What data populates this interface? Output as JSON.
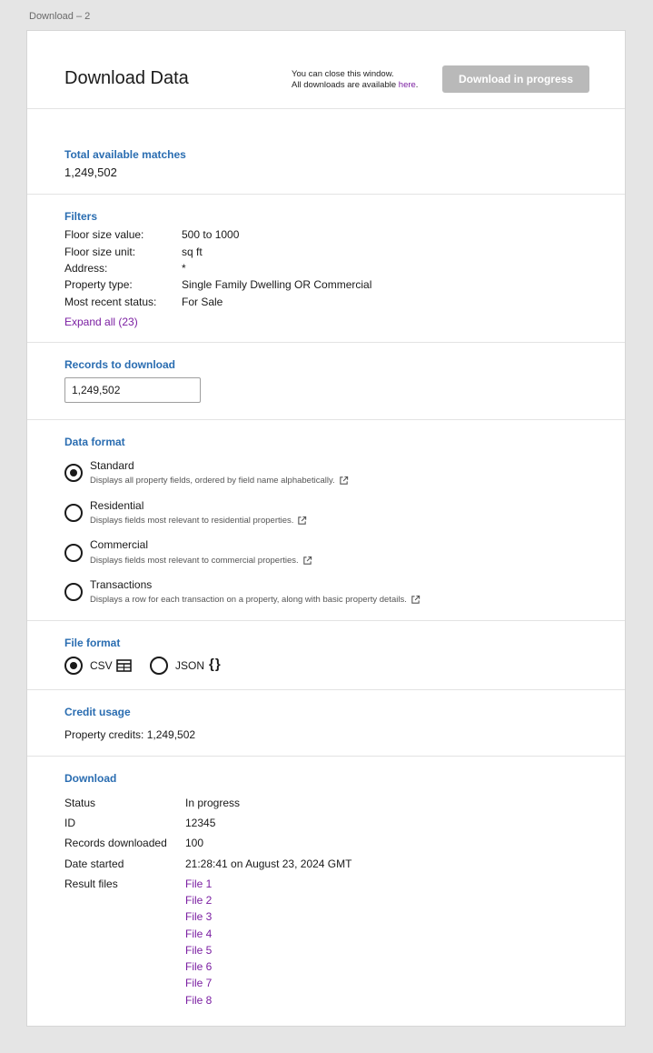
{
  "frame": {
    "label": "Download – 2"
  },
  "header": {
    "title": "Download Data",
    "note_line1": "You can close this window.",
    "note_line2_prefix": "All downloads are available ",
    "note_link": "here",
    "note_suffix": ".",
    "download_button": "Download in progress"
  },
  "matches": {
    "title": "Total available matches",
    "value": "1,249,502"
  },
  "filters": {
    "title": "Filters",
    "rows": [
      {
        "label": "Floor size value:",
        "value": "500 to 1000"
      },
      {
        "label": "Floor size unit:",
        "value": "sq ft"
      },
      {
        "label": "Address:",
        "value": "*"
      },
      {
        "label": "Property type:",
        "value": "Single Family Dwelling OR Commercial"
      },
      {
        "label": "Most recent status:",
        "value": "For Sale"
      }
    ],
    "expand_link": "Expand all (23)"
  },
  "records": {
    "title": "Records to download",
    "value": "1,249,502"
  },
  "data_format": {
    "title": "Data format",
    "selected": "Standard",
    "options": [
      {
        "label": "Standard",
        "desc": "Displays all property fields, ordered by field name alphabetically."
      },
      {
        "label": "Residential",
        "desc": "Displays fields most relevant to residential properties."
      },
      {
        "label": "Commercial",
        "desc": "Displays fields most relevant to commercial properties."
      },
      {
        "label": "Transactions",
        "desc": "Displays a row for each transaction on a property, along with basic property details."
      }
    ]
  },
  "file_format": {
    "title": "File format",
    "selected": "CSV",
    "csv_label": "CSV",
    "csv_icon": "table-icon",
    "json_label": "JSON",
    "json_icon": "braces-icon",
    "json_glyph": "{}"
  },
  "credit": {
    "title": "Credit usage",
    "text": "Property credits: 1,249,502"
  },
  "download": {
    "title": "Download",
    "rows": [
      {
        "label": "Status",
        "value": "In progress"
      },
      {
        "label": "ID",
        "value": "12345"
      },
      {
        "label": "Records downloaded",
        "value": "100"
      },
      {
        "label": "Date started",
        "value": "21:28:41 on August 23, 2024 GMT"
      }
    ],
    "result_label": "Result files",
    "files": [
      "File 1",
      "File 2",
      "File 3",
      "File 4",
      "File 5",
      "File 6",
      "File 7",
      "File 8"
    ]
  },
  "colors": {
    "accent": "#2a6db1",
    "link": "#7b1fa2",
    "button_disabled": "#b9b9b9"
  }
}
